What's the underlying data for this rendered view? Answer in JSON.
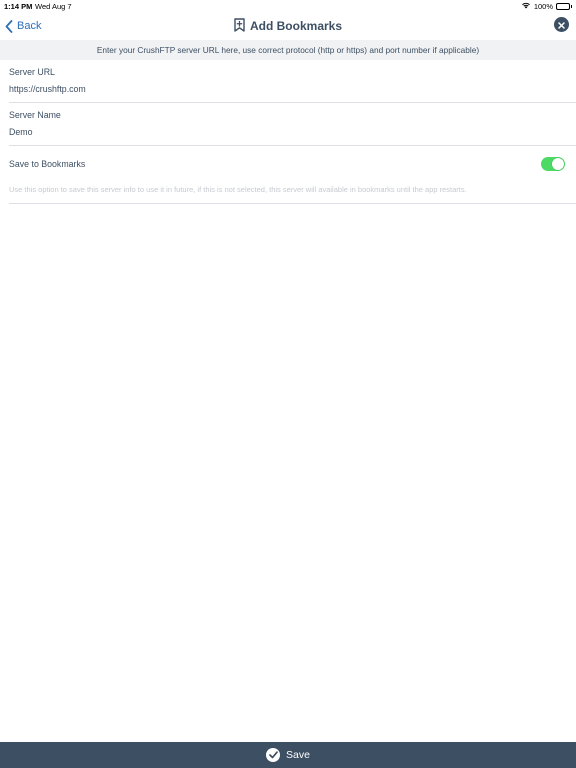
{
  "status_bar": {
    "time": "1:14 PM",
    "date": "Wed Aug 7",
    "battery_percent": "100%",
    "wifi_icon": "wifi-icon",
    "battery_icon": "battery-icon",
    "battery_level": 1.0
  },
  "nav": {
    "back_label": "Back",
    "back_icon": "chevron-left-icon",
    "title": "Add Bookmarks",
    "title_icon": "bookmark-add-icon",
    "close_icon": "close-icon"
  },
  "banner": {
    "text": "Enter your CrushFTP server URL here, use correct protocol (http or https) and port number if applicable)"
  },
  "form": {
    "server_url": {
      "label": "Server URL",
      "value": "https://crushftp.com"
    },
    "server_name": {
      "label": "Server Name",
      "value": "Demo"
    },
    "save_to_bookmarks": {
      "label": "Save to Bookmarks",
      "enabled": true,
      "hint": "Use this option to save this server info to use it in future, if this is not selected, this server will available in bookmarks until the app restarts."
    }
  },
  "footer": {
    "save_label": "Save",
    "save_icon": "checkmark-circle-icon"
  },
  "colors": {
    "primary": "#3d4f63",
    "accent": "#2e6fb6",
    "toggle_on": "#4cd964",
    "banner_bg": "#f1f2f4",
    "hint": "#c5cad0"
  }
}
